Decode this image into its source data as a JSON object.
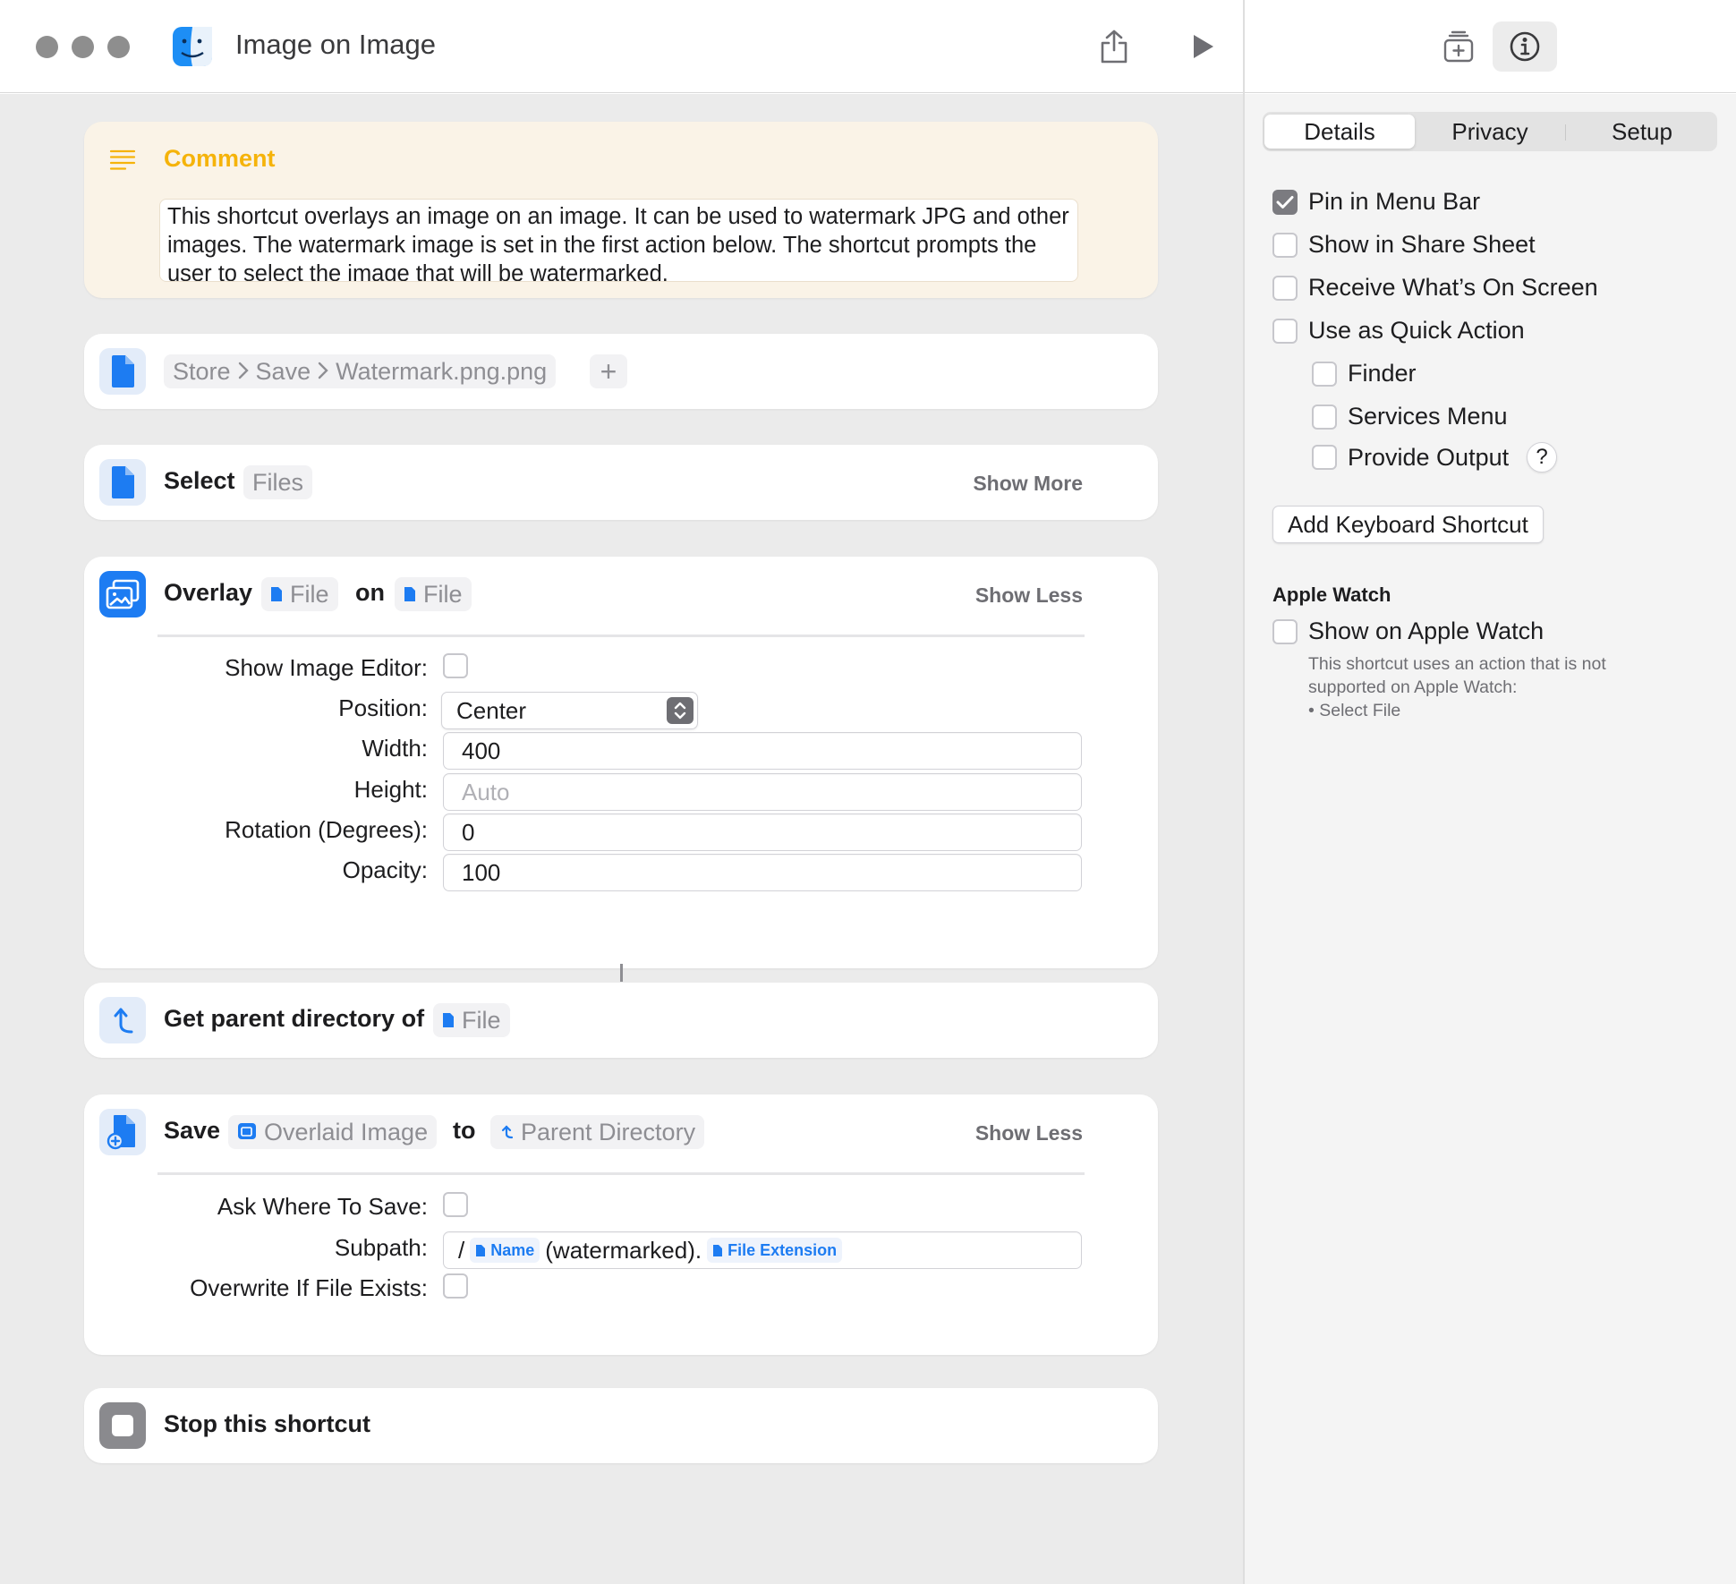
{
  "window": {
    "title": "Image on Image"
  },
  "toolbar": {
    "share_icon": "share-icon",
    "run_icon": "play-icon",
    "library_icon": "add-to-library-icon",
    "info_icon": "info-icon"
  },
  "actions": {
    "comment": {
      "label": "Comment",
      "text": "This shortcut overlays an image on an image. It can be used to watermark JPG and other images. The watermark image is set in the first action below. The shortcut prompts the user to select the image that will be watermarked."
    },
    "store": {
      "path": [
        "Store",
        "Save",
        "Watermark.png.png"
      ],
      "add_label": "+"
    },
    "select": {
      "verb": "Select",
      "token": "Files",
      "toggle": "Show More"
    },
    "overlay": {
      "verb": "Overlay",
      "token1": "File",
      "connector": "on",
      "token2": "File",
      "toggle": "Show Less",
      "params": {
        "image_editor_label": "Show Image Editor:",
        "position_label": "Position:",
        "position_value": "Center",
        "width_label": "Width:",
        "width_value": "400",
        "height_label": "Height:",
        "height_placeholder": "Auto",
        "rotation_label": "Rotation (Degrees):",
        "rotation_value": "0",
        "opacity_label": "Opacity:",
        "opacity_value": "100"
      }
    },
    "parent": {
      "verb": "Get parent directory of",
      "token": "File"
    },
    "save": {
      "verb": "Save",
      "token1": "Overlaid Image",
      "connector": "to",
      "token2": "Parent Directory",
      "toggle": "Show Less",
      "params": {
        "ask_label": "Ask Where To Save:",
        "subpath_label": "Subpath:",
        "subpath_slash": "/",
        "subpath_name": "Name",
        "subpath_text": "(watermarked).",
        "subpath_ext": "File Extension",
        "overwrite_label": "Overwrite If File Exists:"
      }
    },
    "stop": {
      "verb": "Stop this shortcut"
    }
  },
  "sidebar": {
    "tabs": [
      "Details",
      "Privacy",
      "Setup"
    ],
    "active_tab": "Details",
    "options": {
      "pin": {
        "label": "Pin in Menu Bar",
        "checked": true
      },
      "share": {
        "label": "Show in Share Sheet",
        "checked": false
      },
      "receive": {
        "label": "Receive What’s On Screen",
        "checked": false
      },
      "quick": {
        "label": "Use as Quick Action",
        "checked": false
      },
      "finder": {
        "label": "Finder",
        "checked": false
      },
      "services": {
        "label": "Services Menu",
        "checked": false
      },
      "output": {
        "label": "Provide Output",
        "checked": false,
        "help": "?"
      }
    },
    "keyboard_button": "Add Keyboard Shortcut",
    "watch": {
      "heading": "Apple Watch",
      "label": "Show on Apple Watch",
      "note": [
        "This shortcut uses an action that is not",
        "supported on Apple Watch:",
        "• Select File"
      ]
    }
  },
  "colors": {
    "accent": "#1d7cf2",
    "comment_bg": "#faf3e7",
    "comment_label": "#f5b30a",
    "editor_bg": "#ebebeb"
  }
}
